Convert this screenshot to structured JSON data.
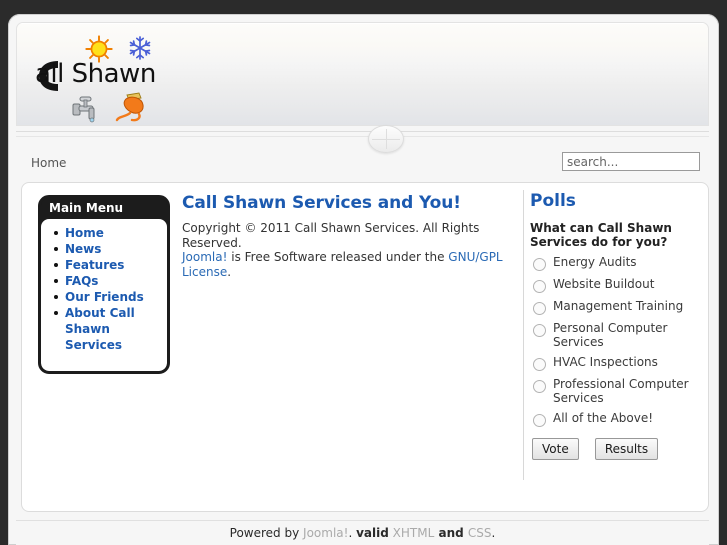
{
  "site": {
    "logo_text": "all Shawn",
    "logo_initial": "C",
    "icons": {
      "sun": "sun-icon",
      "snowflake": "snowflake-icon",
      "faucet": "faucet-icon",
      "plug": "electrical-plug-icon",
      "phone": "phone-receiver-icon"
    }
  },
  "nav": {
    "breadcrumb": "Home",
    "search_placeholder": "search...",
    "search_value": ""
  },
  "main_menu": {
    "title": "Main Menu",
    "items": [
      {
        "label": "Home"
      },
      {
        "label": "News"
      },
      {
        "label": "Features"
      },
      {
        "label": "FAQs"
      },
      {
        "label": "Our Friends"
      },
      {
        "label": "About Call Shawn Services"
      }
    ]
  },
  "article": {
    "title": "Call Shawn Services and You!",
    "copyright": "Copyright © 2011 Call Shawn Services. All Rights Reserved.",
    "license_prefix": "Joomla!",
    "license_middle": " is Free Software released under the ",
    "license_link": "GNU/GPL License",
    "license_suffix": "."
  },
  "polls": {
    "title": "Polls",
    "question": "What can Call Shawn Services do for you?",
    "options": [
      {
        "label": "Energy Audits",
        "selected": false
      },
      {
        "label": "Website Buildout",
        "selected": false
      },
      {
        "label": "Management Training",
        "selected": false
      },
      {
        "label": "Personal Computer Services",
        "selected": false
      },
      {
        "label": "HVAC Inspections",
        "selected": false
      },
      {
        "label": "Professional Computer Services",
        "selected": false
      },
      {
        "label": "All of the Above!",
        "selected": false
      }
    ],
    "vote_button": "Vote",
    "results_button": "Results"
  },
  "footer": {
    "powered_by": "Powered by ",
    "joomla_link": "Joomla!",
    "valid_prefix": ". ",
    "valid_word": "valid",
    "xhtml_link": "XHTML",
    "and_word": " and ",
    "css_link": "CSS",
    "period": "."
  },
  "colors": {
    "accent_blue": "#1c5ab0",
    "link_blue": "#2a6ab5",
    "frame_dark": "#2b2b2b",
    "menu_dark": "#1c1c1c",
    "footer_link_gray": "#aaaaaa"
  }
}
